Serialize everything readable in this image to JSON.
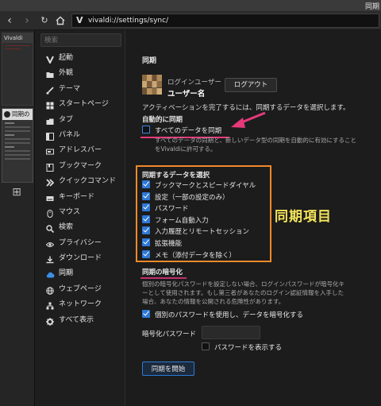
{
  "window": {
    "title": "同期"
  },
  "navbar": {
    "url_logo": "V",
    "url": "vivaldi://settings/sync/"
  },
  "panel": {
    "tab1_label": "Vivaldi",
    "tab2_label": "同期の"
  },
  "sidebar": {
    "search_placeholder": "検索",
    "items": [
      {
        "label": "起動",
        "icon": "vivaldi-icon"
      },
      {
        "label": "外観",
        "icon": "folder-icon"
      },
      {
        "label": "テーマ",
        "icon": "brush-icon"
      },
      {
        "label": "スタートページ",
        "icon": "grid-icon"
      },
      {
        "label": "タブ",
        "icon": "tab-icon"
      },
      {
        "label": "パネル",
        "icon": "panel-icon"
      },
      {
        "label": "アドレスバー",
        "icon": "address-bar-icon"
      },
      {
        "label": "ブックマーク",
        "icon": "bookmark-icon"
      },
      {
        "label": "クイックコマンド",
        "icon": "quick-command-icon"
      },
      {
        "label": "キーボード",
        "icon": "keyboard-icon"
      },
      {
        "label": "マウス",
        "icon": "mouse-icon"
      },
      {
        "label": "検索",
        "icon": "search-icon"
      },
      {
        "label": "プライバシー",
        "icon": "eye-icon"
      },
      {
        "label": "ダウンロード",
        "icon": "download-icon"
      },
      {
        "label": "同期",
        "icon": "cloud-icon"
      },
      {
        "label": "ウェブページ",
        "icon": "globe-icon"
      },
      {
        "label": "ネットワーク",
        "icon": "network-icon"
      },
      {
        "label": "すべて表示",
        "icon": "gear-icon"
      }
    ]
  },
  "main": {
    "title": "同期",
    "login_label": "ログインユーザー",
    "username": "ユーザー名",
    "logout_button": "ログアウト",
    "activation_text": "アクティベーションを完了するには、同期するデータを選択します。",
    "auto_sync_heading": "自動的に同期",
    "sync_all_label": "すべてのデータを同期",
    "sync_all_desc_1": "すべてのデータの同期と、新しいデータ型の同期を自動的に有効にすること",
    "sync_all_desc_2": "をVivaldiに許可する。",
    "select_heading": "同期するデータを選択",
    "data_items": [
      "ブックマークとスピードダイヤル",
      "設定（一部の設定のみ）",
      "パスワード",
      "フォーム自動入力",
      "入力履歴とリモートセッション",
      "拡張機能",
      "メモ（添付データを除く）"
    ],
    "annotation": "同期項目",
    "encryption_heading": "同期の暗号化",
    "enc_desc_1": "個別の暗号化パスワードを設定しない場合、ログインパスワードが暗号化キ",
    "enc_desc_2": "ーとして使用されます。もし第三者があなたのログイン認証情報を入手した",
    "enc_desc_3": "場合、あなたの情報を公開される危険性があります。",
    "use_separate_pw_label": "個別のパスワードを使用し、データを暗号化する",
    "enc_pw_label": "暗号化パスワード",
    "show_pw_label": "パスワードを表示する",
    "start_sync_button": "同期を開始"
  },
  "colors": {
    "accent": "#2e79d6",
    "annotation_box": "#f08a2a",
    "annotation_text": "#f4e45a",
    "pink": "#e5397a"
  }
}
